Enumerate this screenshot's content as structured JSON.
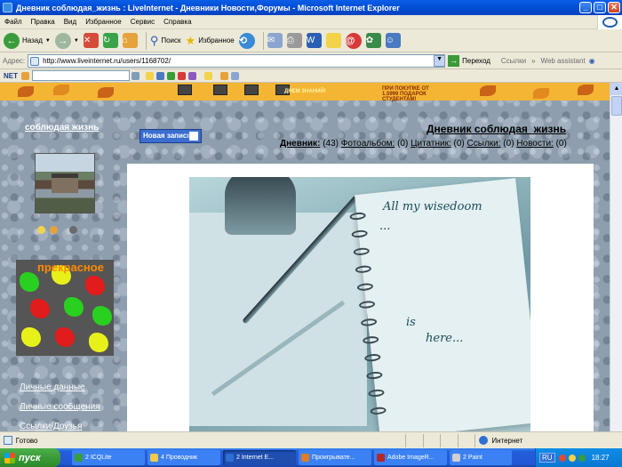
{
  "window": {
    "title": "Дневник соблюдая_жизнь : LiveInternet - Дневники Новости,Форумы - Microsoft Internet Explorer",
    "min": "_",
    "max": "□",
    "close": "✕"
  },
  "menu": [
    "Файл",
    "Правка",
    "Вид",
    "Избранное",
    "Сервис",
    "Справка"
  ],
  "toolbar": {
    "back": "Назад",
    "search": "Поиск",
    "favorites": "Избранное"
  },
  "address": {
    "label": "Адрес:",
    "url": "http://www.liveinternet.ru/users/1168702/",
    "go": "Переход",
    "links": "Ссылки",
    "assistant": "Web assistant"
  },
  "toolbar2": {
    "logo": "NET"
  },
  "banner": {
    "slogan": "ДНЕМ ЗНАНИЙ!",
    "promo": "ПРИ ПОКУПКЕ ОТ 1.5999 ПОДАРОК СТУДЕНТАМ!"
  },
  "blog": {
    "site_title": "соблюдая жизнь",
    "new_post": "Новая запись",
    "diary_title": "Дневник соблюдая_жизнь",
    "stats": {
      "diary_label": "Дневник:",
      "diary_count": "(43)",
      "photo_label": "Фотоальбом:",
      "photo_count": "(0)",
      "quote_label": "Цитатник:",
      "quote_count": "(0)",
      "links_label": "Ссылки:",
      "links_count": "(0)",
      "news_label": "Новости:",
      "news_count": "(0)"
    },
    "side_links": [
      "Личные данные",
      "Личные сообщения",
      "Ссылки/Друзья"
    ],
    "splash_word": "прекрасное"
  },
  "image_text": {
    "line1": "All my wisedoom",
    "line2": "...",
    "line3": "is",
    "line4": "here..."
  },
  "status": {
    "text": "Готово",
    "zone": "Интернет"
  },
  "taskbar": {
    "start": "пуск",
    "tasks": [
      {
        "label": "2 ICQLite",
        "color": "#3a9c3a"
      },
      {
        "label": "4 Проводник",
        "color": "#f2c94c"
      },
      {
        "label": "2 Internet E...",
        "color": "#2f6fd4"
      },
      {
        "label": "Проигрывате...",
        "color": "#e07b2a"
      },
      {
        "label": "Adobe ImageR...",
        "color": "#b02a2a"
      },
      {
        "label": "2 Paint",
        "color": "#d0d0d0"
      }
    ],
    "lang": "RU",
    "clock": "18:27"
  }
}
